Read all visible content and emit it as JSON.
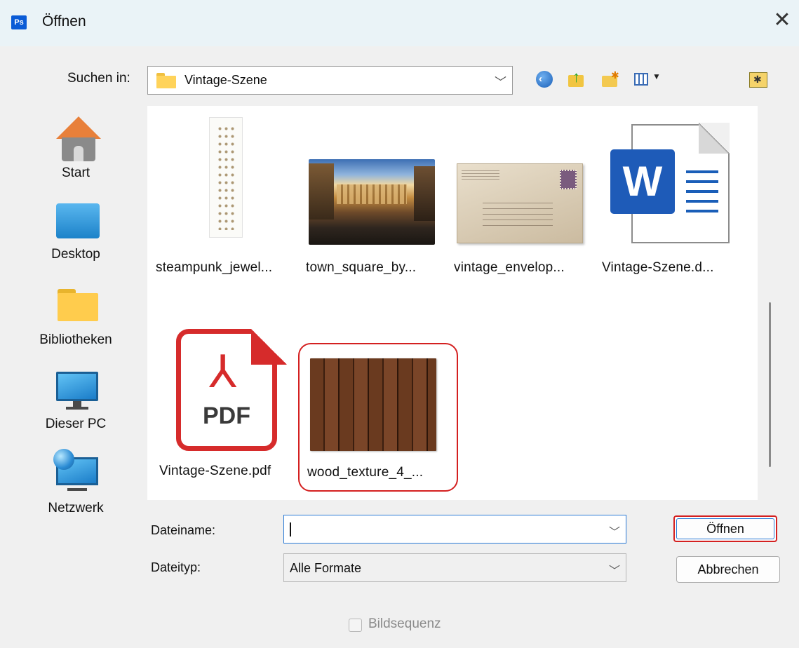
{
  "window": {
    "app_badge": "Ps",
    "title": "Öffnen",
    "close_glyph": "✕"
  },
  "toolbar": {
    "look_in_label": "Suchen in:",
    "look_in_value": "Vintage-Szene",
    "icons": [
      "back-icon",
      "up-folder-icon",
      "new-folder-icon",
      "view-menu-icon",
      "favorites-folder-icon"
    ]
  },
  "places": [
    {
      "label": "Start",
      "icon": "home-icon"
    },
    {
      "label": "Desktop",
      "icon": "desktop-icon"
    },
    {
      "label": "Bibliotheken",
      "icon": "libraries-icon"
    },
    {
      "label": "Dieser PC",
      "icon": "this-pc-icon"
    },
    {
      "label": "Netzwerk",
      "icon": "network-icon"
    }
  ],
  "files": [
    {
      "name": "steampunk_jewel...",
      "kind": "image"
    },
    {
      "name": "town_square_by...",
      "kind": "image"
    },
    {
      "name": "vintage_envelop...",
      "kind": "image"
    },
    {
      "name": "Vintage-Szene.d...",
      "kind": "word-document"
    },
    {
      "name": "Vintage-Szene.pdf",
      "kind": "pdf",
      "pdf_text": "PDF",
      "pdf_symbol": "⅄"
    },
    {
      "name": "wood_texture_4_...",
      "kind": "image",
      "highlighted": true
    }
  ],
  "form": {
    "filename_label": "Dateiname:",
    "filename_value": "",
    "filetype_label": "Dateityp:",
    "filetype_value": "Alle Formate",
    "chevron": "﹀"
  },
  "buttons": {
    "open": "Öffnen",
    "cancel": "Abbrechen"
  },
  "options": {
    "image_sequence_label": "Bildsequenz",
    "image_sequence_checked": false,
    "image_sequence_enabled": false
  },
  "colors": {
    "highlight": "#d42020",
    "focus": "#2a7ad6",
    "titlebar": "#eaf3f7",
    "background": "#f0f0f0"
  }
}
